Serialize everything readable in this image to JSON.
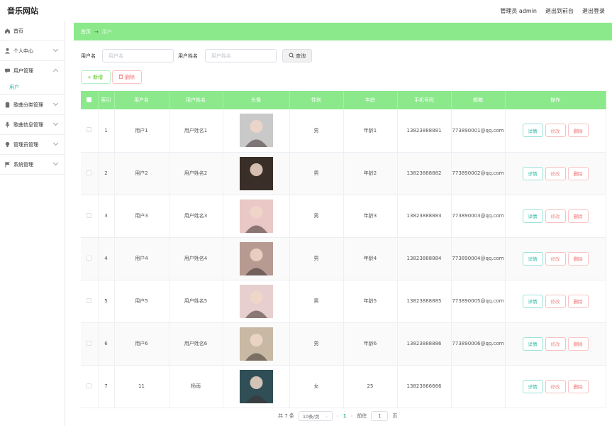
{
  "header": {
    "brand": "音乐网站",
    "admin_label": "管理员 admin",
    "to_front": "退出到前台",
    "logout": "退出登录"
  },
  "sidebar": {
    "items": [
      {
        "label": "首页",
        "icon": "home-icon",
        "has_children": false
      },
      {
        "label": "个人中心",
        "icon": "user-icon",
        "has_children": true
      },
      {
        "label": "用户管理",
        "icon": "chat-icon",
        "has_children": true,
        "expanded": true,
        "children": [
          "用户"
        ]
      },
      {
        "label": "歌曲分类管理",
        "icon": "clipboard-icon",
        "has_children": true
      },
      {
        "label": "歌曲信息管理",
        "icon": "microphone-icon",
        "has_children": true
      },
      {
        "label": "管理员管理",
        "icon": "lightbulb-icon",
        "has_children": true
      },
      {
        "label": "系统管理",
        "icon": "flag-icon",
        "has_children": true
      }
    ]
  },
  "breadcrumb": {
    "home": "首页",
    "arrow": "→",
    "current": "用户"
  },
  "search": {
    "username_label": "用户名",
    "username_placeholder": "用户名",
    "realname_label": "用户姓名",
    "realname_placeholder": "用户姓名",
    "query_label": "查询"
  },
  "actions": {
    "add_label": "+ 新增",
    "delete_label": "删除"
  },
  "table": {
    "headers": [
      "索引",
      "用户名",
      "用户姓名",
      "头像",
      "性别",
      "年龄",
      "手机号码",
      "邮箱",
      "操作"
    ],
    "op_labels": {
      "detail": "详情",
      "edit": "修改",
      "remove": "删除"
    },
    "rows": [
      {
        "index": "1",
        "username": "用户1",
        "realname": "用户姓名1",
        "gender": "男",
        "age": "年龄1",
        "phone": "13823888881",
        "email": "773890001@qq.com",
        "avatar_bg": "#c9c9c9"
      },
      {
        "index": "2",
        "username": "用户2",
        "realname": "用户姓名2",
        "gender": "男",
        "age": "年龄2",
        "phone": "13823888882",
        "email": "773890002@qq.com",
        "avatar_bg": "#3a2e28"
      },
      {
        "index": "3",
        "username": "用户3",
        "realname": "用户姓名3",
        "gender": "男",
        "age": "年龄3",
        "phone": "13823888883",
        "email": "773890003@qq.com",
        "avatar_bg": "#e9c8c6"
      },
      {
        "index": "4",
        "username": "用户4",
        "realname": "用户姓名4",
        "gender": "男",
        "age": "年龄4",
        "phone": "13823888884",
        "email": "773890004@qq.com",
        "avatar_bg": "#b79a92"
      },
      {
        "index": "5",
        "username": "用户5",
        "realname": "用户姓名5",
        "gender": "男",
        "age": "年龄5",
        "phone": "13823888885",
        "email": "773890005@qq.com",
        "avatar_bg": "#e8cfcf"
      },
      {
        "index": "6",
        "username": "用户6",
        "realname": "用户姓名6",
        "gender": "男",
        "age": "年龄6",
        "phone": "13823888886",
        "email": "773890006@qq.com",
        "avatar_bg": "#c7b9a3"
      },
      {
        "index": "7",
        "username": "11",
        "realname": "杨雨",
        "gender": "女",
        "age": "25",
        "phone": "13823866666",
        "email": "",
        "avatar_bg": "#2f4e55"
      }
    ]
  },
  "pagination": {
    "total_text": "共 7 条",
    "page_size": "10条/页",
    "current_page": "1",
    "goto_label": "前往",
    "goto_value": "1",
    "page_suffix": "页"
  },
  "colors": {
    "accent": "#8be98b",
    "teal": "#2fb9a7",
    "danger": "#f56c6c"
  }
}
